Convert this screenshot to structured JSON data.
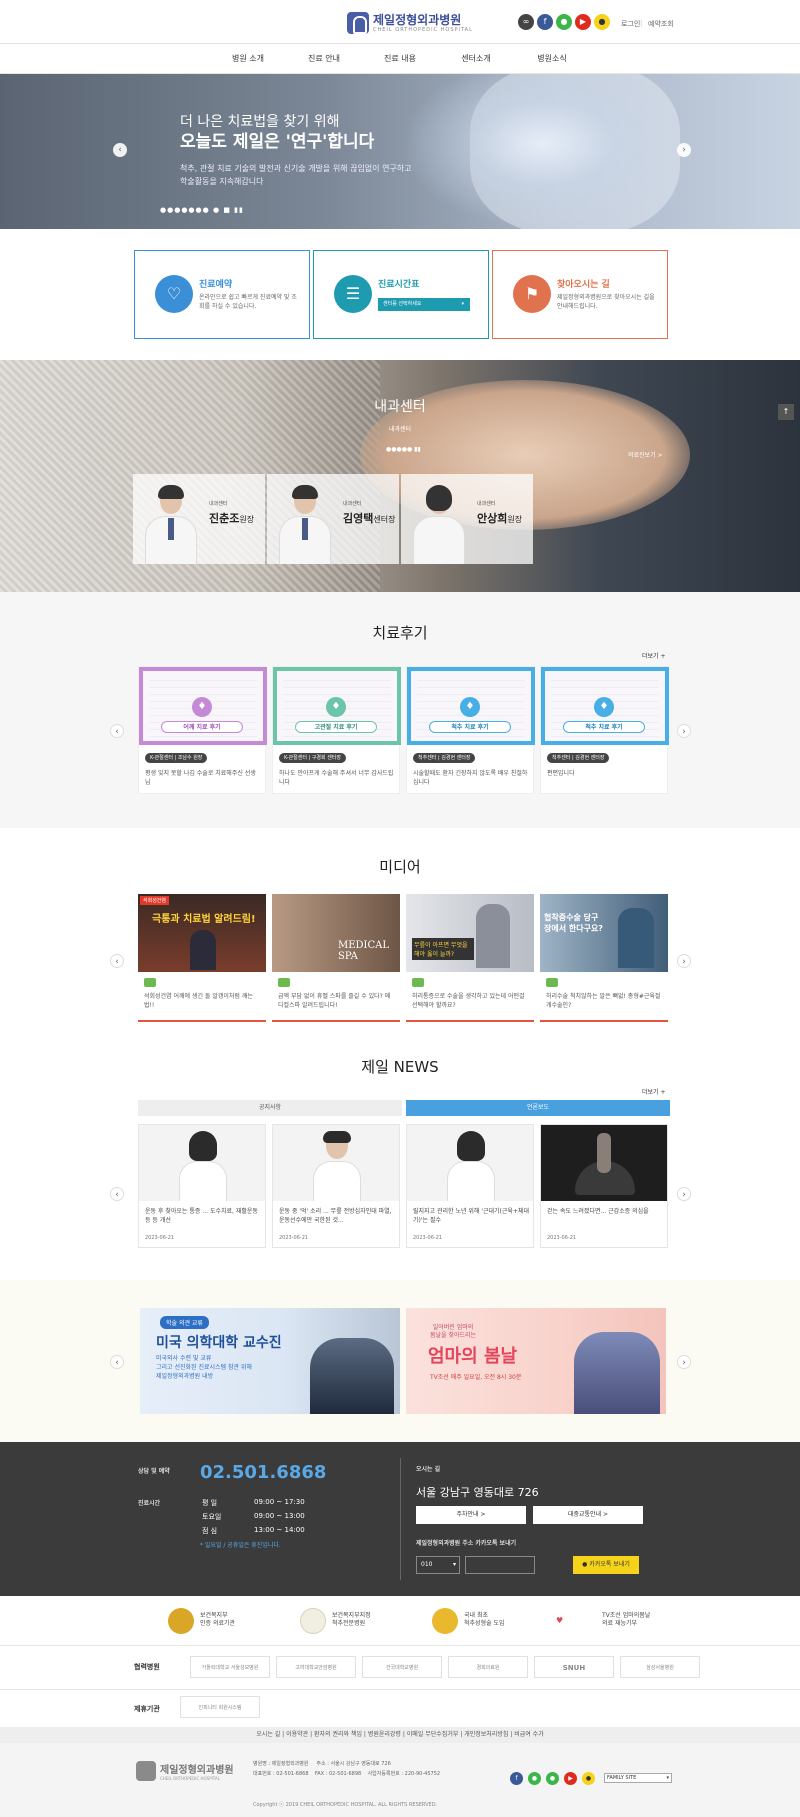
{
  "header": {
    "logo_title": "제일정형외과병원",
    "logo_sub": "CHEIL ORTHOPEDIC HOSPITAL",
    "util": [
      "로그인",
      "예약조회"
    ]
  },
  "nav": [
    "병원 소개",
    "진료 안내",
    "진료 내용",
    "센터소개",
    "병원소식"
  ],
  "hero": {
    "line1": "더 나은 치료법을 찾기 위해",
    "line2": "오늘도 제일은 '연구'합니다",
    "desc": "척추, 관절 치료 기술의 발전과 신기술 개발을 위해 끊임없이 연구하고 학술활동을 지속해갑니다",
    "dots": "●●●●●●● ● ■ ▮▮"
  },
  "quick": [
    {
      "title": "진료예약",
      "desc": "온라인으로 쉽고 빠르게 진료예약 및 조회를 하실 수 있습니다.",
      "color": "#3b8fd6"
    },
    {
      "title": "진료시간표",
      "select": "센터를 선택하세요",
      "color": "#1f9bb0"
    },
    {
      "title": "찾아오시는 길",
      "desc": "제일정형외과병원으로 찾아오시는 길을 안내해드립니다.",
      "color": "#e0734d"
    }
  ],
  "center": {
    "title": "내과센터",
    "sub": "내과센터",
    "more": "의료진보기 >",
    "dots": "●●●●● ▮▮",
    "doctors": [
      {
        "role": "내과센터",
        "name": "진춘조",
        "title": "원장"
      },
      {
        "role": "내과센터",
        "name": "김영택",
        "title": "센터장"
      },
      {
        "role": "내과센터",
        "name": "안상희",
        "title": "원장"
      }
    ]
  },
  "review": {
    "title": "치료후기",
    "more": "더보기 +",
    "cards": [
      {
        "label": "어깨 치료 후기",
        "tag": "K-관절센터 | 조남수 원장",
        "text": "평생 잊지 못할 나김 수술로 치료해주신 선생님",
        "color": "#c58ad6"
      },
      {
        "label": "고관절 치료 후기",
        "tag": "K-관절센터 | 구경회 센터장",
        "text": "하나도 안아프게 수술해 주셔서 너무 감사드립니다",
        "color": "#6cc5a8"
      },
      {
        "label": "척추 치료 후기",
        "tag": "척추센터 | 김경현 센터장",
        "text": "시술할때도 환자 긴장하지 않도록 배우 친절하십니다",
        "color": "#48aee6"
      },
      {
        "label": "척추 치료 후기",
        "tag": "척추센터 | 김경현 센터장",
        "text": "편편입니다",
        "color": "#48aee6"
      }
    ]
  },
  "media": {
    "title": "미디어",
    "cards": [
      {
        "headline": "극통과 치료법 알려드림!",
        "badge": "석회성건염",
        "text": "석회성건염 어깨에 생긴 돌 알갱이처럼 깨는 법!!"
      },
      {
        "headline": "MEDICAL SPA",
        "text": "급액 부담 없이 휴멜 스파를 즐길 수 있다? 메디컬스파 알려드립니다!"
      },
      {
        "headline": "무릎이 아프면 무엇을 해야 옳이 늘까?",
        "text": "허리통증으로 수술을 생각하고 있는데 어떤걸 선택해야 할까요?"
      },
      {
        "headline": "협착증수술 당구장에서 한다구요?",
        "text": "허리수술 척치않하는 알은 뼈없! 총형#근육절개수술인?"
      }
    ]
  },
  "news": {
    "title": "제일 NEWS",
    "more": "더보기 +",
    "tabs": [
      "공지사항",
      "언론보도"
    ],
    "cards": [
      {
        "text": "운동 후 찾아오는 통증 ... 도수치료, 재활운동 등 등 개선",
        "date": "2023-06-21"
      },
      {
        "text": "운동 중 '억' 소리 ... 무릎 전방십자인대 파열, 운동선수에만 국한된 것...",
        "date": "2023-06-21"
      },
      {
        "text": "릴지지고 관리한 노년 위해 '근대기(근육+체대기)'는 필수",
        "date": "2023-06-21"
      },
      {
        "text": "걷는 속도 느려졌다면... 근감소증 의심을",
        "date": "2023-06-21"
      }
    ]
  },
  "banners": [
    {
      "tag": "학술 의견 교류",
      "title": "미국 의학대학 교수진",
      "desc1": "미국외사 수련 및 교류",
      "desc2": "그리고 선진화된 진료시스템 참관 위해",
      "desc3": "제일정형외과병원 내방"
    },
    {
      "pre1": "일어버린 엄마의",
      "pre2": "봄날을 찾아드리는",
      "title": "엄마의 봄날",
      "tv": "TV조선 매주 일요일, 오전 8시 30분"
    }
  ],
  "footer": {
    "consult_label": "상담 및 예약",
    "phone": "02.501.6868",
    "hours_label": "진료시간",
    "hours": [
      {
        "day": "평 일",
        "time": "09:00 ~ 17:30"
      },
      {
        "day": "토요일",
        "time": "09:00 ~ 13:00"
      },
      {
        "day": "점 심",
        "time": "13:00 ~ 14:00"
      }
    ],
    "note": "* 일요일 / 공휴일은 휴진입니다.",
    "loc_label": "오시는 길",
    "address": "서울 강남구 영동대로 726",
    "btn1": "주차안내 >",
    "btn2": "대중교통안내 >",
    "kakao_label": "제일정형외과병원 주소 카카오톡 보내기",
    "phone_prefix": "010",
    "kakao_btn": "카카오톡 보내기"
  },
  "certs": [
    {
      "line1": "보건복지부",
      "line2": "인증 의료기관"
    },
    {
      "line1": "보건복지부지정",
      "line2": "척추전문병원"
    },
    {
      "line1": "국내 최초",
      "line2": "척추성형술 도입"
    },
    {
      "line1": "TV조선 엄마의봄날",
      "line2": "의료 재능기부"
    }
  ],
  "partners": {
    "label1": "협력병원",
    "list1": [
      "가톨릭대학교 서울성모병원",
      "고려대학교안암병원",
      "건국대학교병원",
      "경희의료원",
      "SNUH",
      "삼성서울병원"
    ],
    "label2": "제휴기관",
    "list2": [
      "인피니티 회원시스템"
    ]
  },
  "bottom": {
    "menu": "오시는 길 | 이용약관 | 환자의 권리와 책임 | 병원윤리강령 | 이메일 무단수집거부 | 개인정보처리방침 | 비급여 수가",
    "logo_title": "제일정형외과병원",
    "logo_sub": "CHEIL ORTHOPEDIC HOSPITAL",
    "info": "병원명 : 제일정형외과병원     주소 : 서울시 강남구 영동대로 726\n대표번호 : 02-501-6868    FAX : 02-501-6898    사업자등록번호 : 220-90-45752",
    "copy": "Copyright ⓒ 2019 CHEIL ORTHOPEDIC HOSPITAL. ALL RIGHTS RESERVED.",
    "family": "FAMILY SITE"
  }
}
